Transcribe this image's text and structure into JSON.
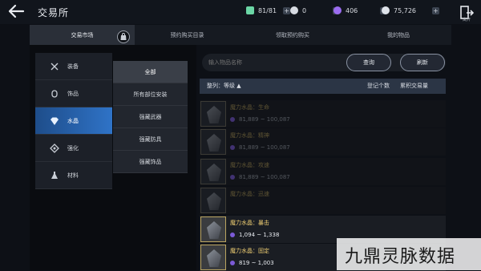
{
  "header": {
    "title": "交易所",
    "currencies": [
      {
        "name": "stamina",
        "value": "81/81",
        "color": "#6bd6a5"
      },
      {
        "name": "silver",
        "value": "0",
        "color": "#d7dbe2"
      },
      {
        "name": "gem",
        "value": "406",
        "color": "#9b6cf0"
      },
      {
        "name": "coin",
        "value": "75,726",
        "color": "#dfe3ea"
      }
    ],
    "exit_label": "离开"
  },
  "tabs": [
    "交易市场",
    "预约购买目录",
    "领取预约购买",
    "我的物品"
  ],
  "categories": [
    {
      "label": "装备",
      "icon": "crossed-swords-icon"
    },
    {
      "label": "饰品",
      "icon": "ring-icon"
    },
    {
      "label": "水晶",
      "icon": "crystal-icon",
      "active": true
    },
    {
      "label": "强化",
      "icon": "diamond-rune-icon"
    },
    {
      "label": "材料",
      "icon": "flask-icon"
    }
  ],
  "subcategories": [
    {
      "label": "全部",
      "active": true
    },
    {
      "label": "所有部位安装"
    },
    {
      "label": "强藏武器"
    },
    {
      "label": "强藏防具"
    },
    {
      "label": "强藏饰品"
    }
  ],
  "search": {
    "placeholder": "输入物品名称",
    "query_button": "查询",
    "refresh_button": "刷新"
  },
  "sortbar": {
    "sort_label": "整列：等级 ▲",
    "col_count": "登记个数",
    "col_volume": "累积交易量"
  },
  "items": [
    {
      "name": "魔力水晶：生命",
      "price": "81,889 ~ 100,087"
    },
    {
      "name": "魔力水晶：精神",
      "price": "81,889 ~ 100,087"
    },
    {
      "name": "魔力水晶：攻速",
      "price": "81,889 ~ 100,087"
    },
    {
      "name": "魔力水晶：迅速",
      "price": ""
    },
    {
      "name": "魔力水晶：暴击",
      "price": "1,094 ~ 1,338",
      "highlight": true
    },
    {
      "name": "魔力水晶：固定",
      "price": "819 ~ 1,003",
      "highlight": true
    }
  ],
  "watermark": "九鼎灵脉数据"
}
